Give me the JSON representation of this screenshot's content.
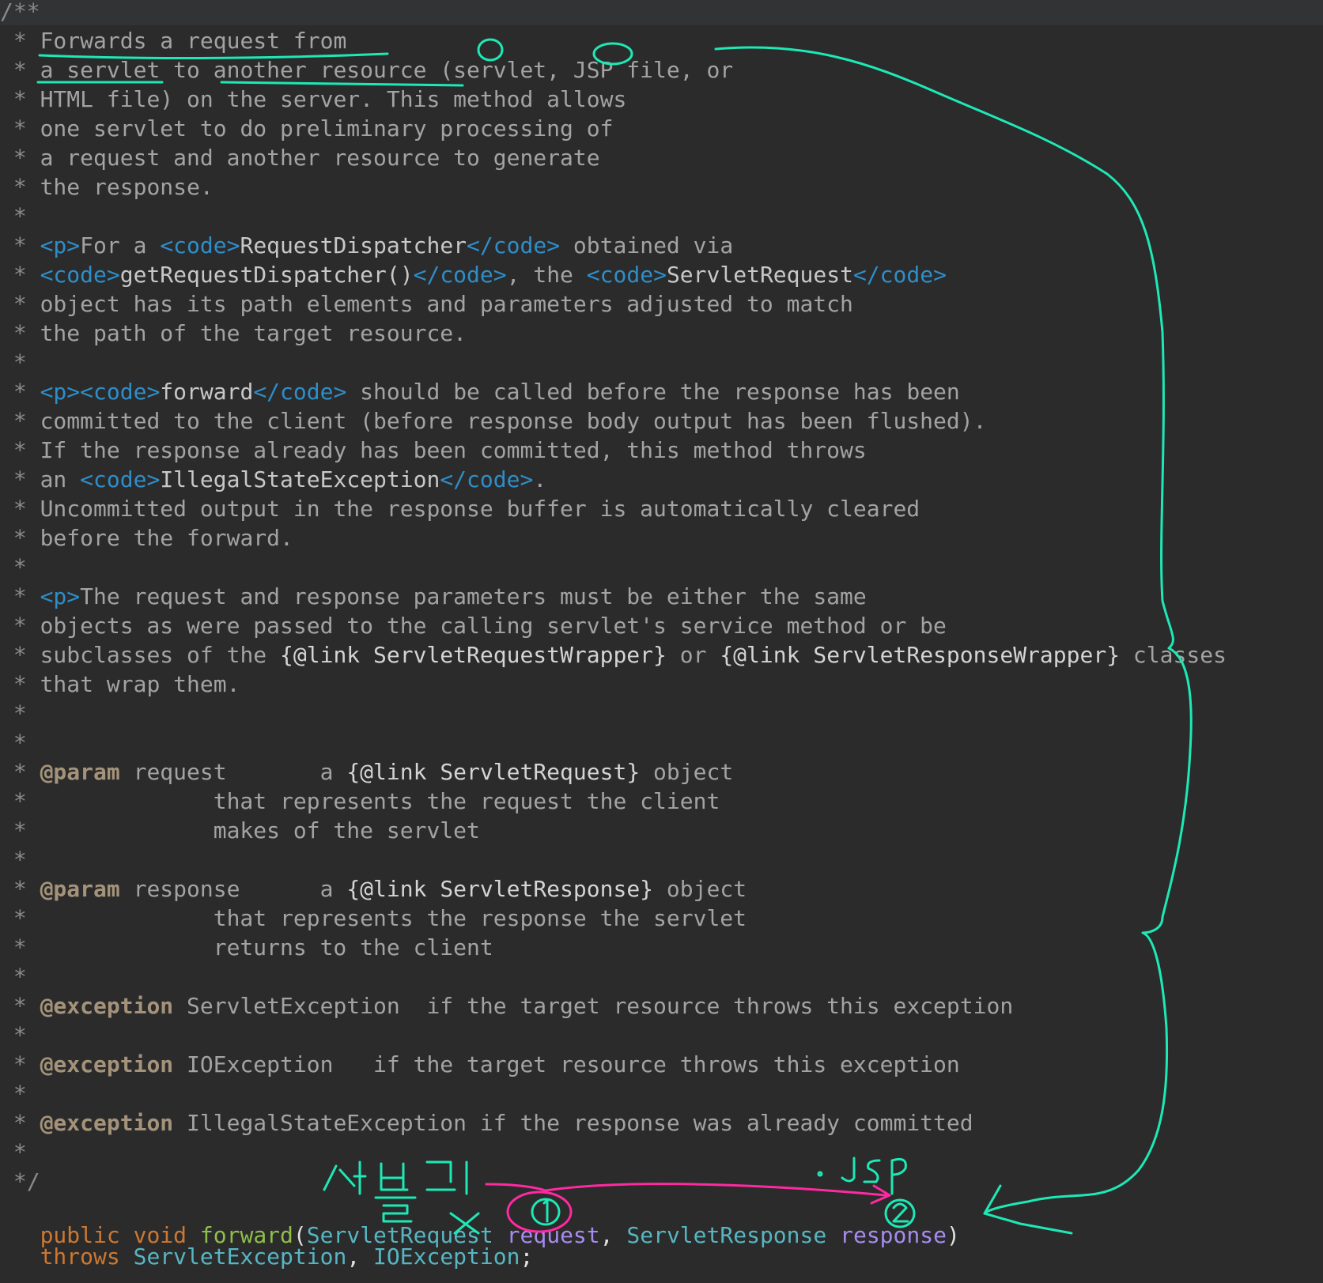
{
  "editor": {
    "language": "java",
    "comment_open": "/**",
    "doc_lines": [
      {
        "star": " * ",
        "parts": [
          {
            "t": "Forwards a request from",
            "c": "doc"
          }
        ]
      },
      {
        "star": " * ",
        "parts": [
          {
            "t": "a servlet to another resource (servlet, JSP file, or",
            "c": "doc"
          }
        ]
      },
      {
        "star": " * ",
        "parts": [
          {
            "t": "HTML file) on the server. This method allows",
            "c": "doc"
          }
        ]
      },
      {
        "star": " * ",
        "parts": [
          {
            "t": "one servlet to do preliminary processing of",
            "c": "doc"
          }
        ]
      },
      {
        "star": " * ",
        "parts": [
          {
            "t": "a request and another resource to generate",
            "c": "doc"
          }
        ]
      },
      {
        "star": " * ",
        "parts": [
          {
            "t": "the response.",
            "c": "doc"
          }
        ]
      },
      {
        "star": " *",
        "parts": []
      },
      {
        "star": " * ",
        "parts": [
          {
            "t": "<p>",
            "c": "tag"
          },
          {
            "t": "For a ",
            "c": "doc"
          },
          {
            "t": "<code>",
            "c": "tag"
          },
          {
            "t": "RequestDispatcher",
            "c": "tagtext"
          },
          {
            "t": "</code>",
            "c": "tag"
          },
          {
            "t": " obtained via",
            "c": "doc"
          }
        ]
      },
      {
        "star": " * ",
        "parts": [
          {
            "t": "<code>",
            "c": "tag"
          },
          {
            "t": "getRequestDispatcher()",
            "c": "tagtext"
          },
          {
            "t": "</code>",
            "c": "tag"
          },
          {
            "t": ", the ",
            "c": "doc"
          },
          {
            "t": "<code>",
            "c": "tag"
          },
          {
            "t": "ServletRequest",
            "c": "tagtext"
          },
          {
            "t": "</code>",
            "c": "tag"
          }
        ]
      },
      {
        "star": " * ",
        "parts": [
          {
            "t": "object has its path elements and parameters adjusted to match",
            "c": "doc"
          }
        ]
      },
      {
        "star": " * ",
        "parts": [
          {
            "t": "the path of the target resource.",
            "c": "doc"
          }
        ]
      },
      {
        "star": " *",
        "parts": []
      },
      {
        "star": " * ",
        "parts": [
          {
            "t": "<p><code>",
            "c": "tag"
          },
          {
            "t": "forward",
            "c": "tagtext"
          },
          {
            "t": "</code>",
            "c": "tag"
          },
          {
            "t": " should be called before the response has been",
            "c": "doc"
          }
        ]
      },
      {
        "star": " * ",
        "parts": [
          {
            "t": "committed to the client (before response body output has been flushed).",
            "c": "doc"
          }
        ]
      },
      {
        "star": " * ",
        "parts": [
          {
            "t": "If the response already has been committed, this method throws",
            "c": "doc"
          }
        ]
      },
      {
        "star": " * ",
        "parts": [
          {
            "t": "an ",
            "c": "doc"
          },
          {
            "t": "<code>",
            "c": "tag"
          },
          {
            "t": "IllegalStateException",
            "c": "tagtext"
          },
          {
            "t": "</code>",
            "c": "tag"
          },
          {
            "t": ".",
            "c": "doc"
          }
        ]
      },
      {
        "star": " * ",
        "parts": [
          {
            "t": "Uncommitted output in the response buffer is automatically cleared",
            "c": "doc"
          }
        ]
      },
      {
        "star": " * ",
        "parts": [
          {
            "t": "before the forward.",
            "c": "doc"
          }
        ]
      },
      {
        "star": " *",
        "parts": []
      },
      {
        "star": " * ",
        "parts": [
          {
            "t": "<p>",
            "c": "tag"
          },
          {
            "t": "The request and response parameters must be either the same",
            "c": "doc"
          }
        ]
      },
      {
        "star": " * ",
        "parts": [
          {
            "t": "objects as were passed to the calling servlet's service method or be",
            "c": "doc"
          }
        ]
      },
      {
        "star": " * ",
        "parts": [
          {
            "t": "subclasses of the ",
            "c": "doc"
          },
          {
            "t": "{@link ServletRequestWrapper}",
            "c": "link"
          },
          {
            "t": " or ",
            "c": "doc"
          },
          {
            "t": "{@link ServletResponseWrapper}",
            "c": "link"
          },
          {
            "t": " classes",
            "c": "doc"
          }
        ]
      },
      {
        "star": " * ",
        "parts": [
          {
            "t": "that wrap them.",
            "c": "doc"
          }
        ]
      },
      {
        "star": " *",
        "parts": []
      },
      {
        "star": " *",
        "parts": []
      },
      {
        "star": " * ",
        "parts": [
          {
            "t": "@param",
            "c": "tagname"
          },
          {
            "t": " request       a ",
            "c": "doc"
          },
          {
            "t": "{@link ServletRequest}",
            "c": "link"
          },
          {
            "t": " object",
            "c": "doc"
          }
        ]
      },
      {
        "star": " *              ",
        "parts": [
          {
            "t": "that represents the request the client",
            "c": "doc"
          }
        ]
      },
      {
        "star": " *              ",
        "parts": [
          {
            "t": "makes of the servlet",
            "c": "doc"
          }
        ]
      },
      {
        "star": " *",
        "parts": []
      },
      {
        "star": " * ",
        "parts": [
          {
            "t": "@param",
            "c": "tagname"
          },
          {
            "t": " response      a ",
            "c": "doc"
          },
          {
            "t": "{@link ServletResponse}",
            "c": "link"
          },
          {
            "t": " object",
            "c": "doc"
          }
        ]
      },
      {
        "star": " *              ",
        "parts": [
          {
            "t": "that represents the response the servlet",
            "c": "doc"
          }
        ]
      },
      {
        "star": " *              ",
        "parts": [
          {
            "t": "returns to the client",
            "c": "doc"
          }
        ]
      },
      {
        "star": " *",
        "parts": []
      },
      {
        "star": " * ",
        "parts": [
          {
            "t": "@exception",
            "c": "tagname"
          },
          {
            "t": " ServletException  if the target resource throws this exception",
            "c": "doc"
          }
        ]
      },
      {
        "star": " *",
        "parts": []
      },
      {
        "star": " * ",
        "parts": [
          {
            "t": "@exception",
            "c": "tagname"
          },
          {
            "t": " IOException   if the target resource throws this exception",
            "c": "doc"
          }
        ]
      },
      {
        "star": " *",
        "parts": []
      },
      {
        "star": " * ",
        "parts": [
          {
            "t": "@exception",
            "c": "tagname"
          },
          {
            "t": " IllegalStateException if the response was already committed",
            "c": "doc"
          }
        ]
      },
      {
        "star": " *",
        "parts": []
      }
    ],
    "comment_close": " */",
    "code_lines": [
      {
        "parts": [
          {
            "t": "   ",
            "c": "plain"
          },
          {
            "t": "public",
            "c": "kw"
          },
          {
            "t": " ",
            "c": "plain"
          },
          {
            "t": "void",
            "c": "kw"
          },
          {
            "t": " ",
            "c": "plain"
          },
          {
            "t": "forward",
            "c": "fn"
          },
          {
            "t": "(",
            "c": "plain"
          },
          {
            "t": "ServletRequest",
            "c": "type"
          },
          {
            "t": " ",
            "c": "plain"
          },
          {
            "t": "request",
            "c": "param"
          },
          {
            "t": ", ",
            "c": "plain"
          },
          {
            "t": "ServletResponse",
            "c": "type"
          },
          {
            "t": " ",
            "c": "plain"
          },
          {
            "t": "response",
            "c": "param"
          },
          {
            "t": ")",
            "c": "plain"
          }
        ]
      },
      {
        "parts": [
          {
            "t": "   ",
            "c": "plain"
          },
          {
            "t": "throws",
            "c": "kw"
          },
          {
            "t": " ",
            "c": "plain"
          },
          {
            "t": "ServletException",
            "c": "type"
          },
          {
            "t": ", ",
            "c": "plain"
          },
          {
            "t": "IOException",
            "c": "type"
          },
          {
            "t": ";",
            "c": "plain"
          }
        ]
      }
    ]
  },
  "annotations": {
    "ink_green": "#1de9b6",
    "ink_magenta": "#ff2aa0",
    "marker_one": "1",
    "marker_two": "2",
    "handwritten_korean": "서블릿",
    "handwritten_korean_2": "글 X",
    "handwritten_jsp": "· JSP"
  }
}
